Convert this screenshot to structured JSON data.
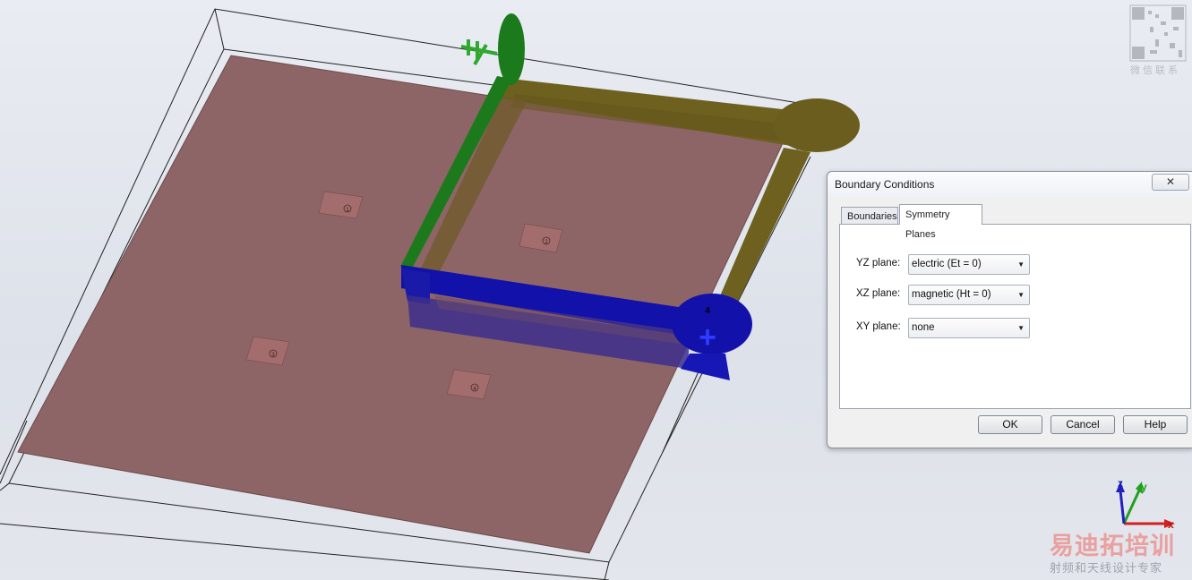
{
  "dialog": {
    "title": "Boundary Conditions",
    "close_glyph": "✕",
    "tabs": [
      {
        "label": "Boundaries",
        "active": false
      },
      {
        "label": "Symmetry Planes",
        "active": true
      }
    ],
    "planes": [
      {
        "label": "YZ plane:",
        "value": "electric (Et = 0)"
      },
      {
        "label": "XZ plane:",
        "value": "magnetic (Ht = 0)"
      },
      {
        "label": "XY plane:",
        "value": "none"
      }
    ],
    "buttons": {
      "ok": "OK",
      "cancel": "Cancel",
      "help": "Help"
    }
  },
  "axes": {
    "x": "x",
    "y": "y",
    "z": "z"
  },
  "port_labels": [
    "1",
    "2",
    "3",
    "4"
  ],
  "port_marker": "+",
  "watermark": {
    "qr_caption": "微信联系",
    "brand": "易迪拓培训",
    "tagline": "射频和天线设计专家"
  },
  "colors": {
    "substrate": "#8b6465",
    "patch": "#a56a6a",
    "feed_green": "#1f7a1f",
    "feed_olive": "#6b5f1e",
    "feed_blue": "#1414b0"
  }
}
